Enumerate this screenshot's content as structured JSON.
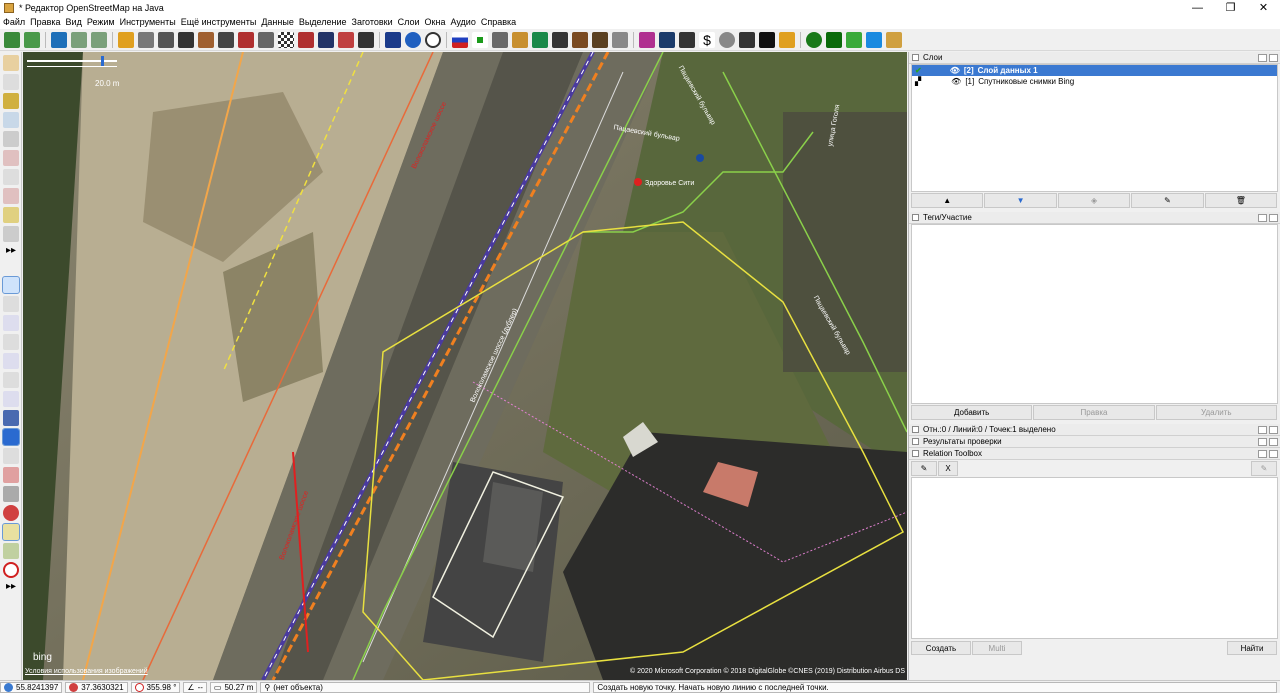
{
  "window": {
    "title": "* Редактор OpenStreetMap на Java",
    "min": "—",
    "max": "❐",
    "close": "✕"
  },
  "menu": [
    "Файл",
    "Правка",
    "Вид",
    "Режим",
    "Инструменты",
    "Ещё инструменты",
    "Данные",
    "Выделение",
    "Заготовки",
    "Слои",
    "Окна",
    "Аудио",
    "Справка"
  ],
  "toolbar_icons": [
    "download-icon",
    "upload-icon",
    "bing-icon",
    "imagery-icon",
    "imagery2-icon",
    "bollard-icon",
    "gate-icon",
    "tractor-icon",
    "railway-icon",
    "building-icon",
    "wall-icon",
    "tower-icon",
    "checker-icon",
    "brick-icon",
    "sign-icon",
    "line-icon",
    "car-icon",
    "ticket-icon",
    "globe-icon",
    "clock-icon",
    "flag-icon",
    "cross-icon",
    "fuel-icon",
    "tree-icon",
    "phone-icon",
    "castle-icon",
    "factory-icon",
    "church-icon",
    "cart-icon",
    "shirt-icon",
    "camera-icon",
    "dollar-icon",
    "paperclip-icon",
    "person-icon",
    "tree2-icon",
    "forest-icon",
    "grass-icon",
    "water-icon",
    "wheat-icon"
  ],
  "scale": {
    "label": "20.0 m"
  },
  "map_labels": {
    "road1": "Волоколамское шоссе",
    "road2": "Волоколамское шоссе",
    "road3": "Волоколамское шоссе (дублер)",
    "blvd1": "Пацаевский бульвар",
    "blvd2": "Пацаевский бульвар",
    "blvd3": "Пацаевский бульвар",
    "street": "улица Гоголя",
    "poi": "Здоровье Сити",
    "bing": "bing",
    "terms": "Условия использования изображений",
    "copyright": "© 2020 Microsoft Corporation © 2018 DigitalGlobe ©CNES (2019) Distribution Airbus DS"
  },
  "layers_panel": {
    "title": "Слои",
    "layers": [
      {
        "index": "[2]",
        "name": "Слой данных 1",
        "selected": true
      },
      {
        "index": "[1]",
        "name": "Спутниковые снимки Bing",
        "selected": false
      }
    ]
  },
  "tags_panel": {
    "title": "Теги/Участие",
    "add": "Добавить",
    "edit": "Правка",
    "delete": "Удалить"
  },
  "selection_panel": {
    "title": "Отн.:0 / Линий:0 / Точек:1 выделено"
  },
  "validation_panel": {
    "title": "Результаты проверки"
  },
  "relation_toolbox": {
    "title": "Relation Toolbox",
    "x": "X"
  },
  "bottom_buttons": {
    "create": "Создать",
    "multi": "Multi",
    "find": "Найти"
  },
  "status": {
    "lat": "55.8241397",
    "lon": "37.3630321",
    "heading": "355.98 °",
    "angle": "--",
    "distance": "50.27 m",
    "object": "(нет объекта)",
    "message": "Создать новую точку. Начать новую линию с последней точки."
  }
}
